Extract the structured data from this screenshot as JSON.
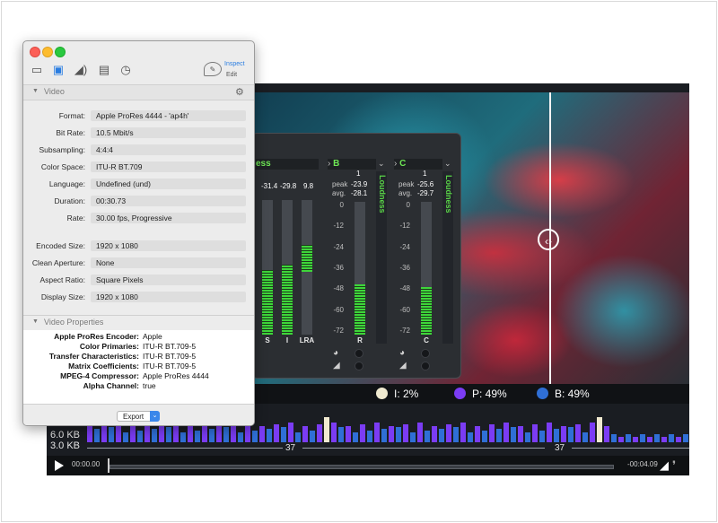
{
  "window": {
    "toolbar": {
      "inspect_label": "Inspect",
      "edit_label": "Edit",
      "icons": [
        "document-icon",
        "video-icon",
        "audio-icon",
        "subtitle-icon",
        "clock-icon"
      ]
    },
    "video_section": {
      "title": "Video",
      "properties": [
        {
          "label": "Format:",
          "value": "Apple ProRes 4444 - 'ap4h'"
        },
        {
          "label": "Bit Rate:",
          "value": "10.5 Mbit/s"
        },
        {
          "label": "Subsampling:",
          "value": "4:4:4"
        },
        {
          "label": "Color Space:",
          "value": "ITU-R BT.709"
        },
        {
          "label": "Language:",
          "value": "Undefined (und)"
        },
        {
          "label": "Duration:",
          "value": "00:30.73"
        },
        {
          "label": "Rate:",
          "value": "30.00 fps, Progressive"
        },
        {
          "label": "Encoded Size:",
          "value": "1920 x 1080"
        },
        {
          "label": "Clean Aperture:",
          "value": "None"
        },
        {
          "label": "Aspect Ratio:",
          "value": "Square Pixels"
        },
        {
          "label": "Display Size:",
          "value": "1920 x 1080"
        }
      ]
    },
    "video_properties": {
      "title": "Video Properties",
      "rows": [
        {
          "label": "Apple ProRes Encoder:",
          "value": "Apple"
        },
        {
          "label": "Color Primaries:",
          "value": "ITU-R BT.709-5"
        },
        {
          "label": "Transfer Characteristics:",
          "value": "ITU-R BT.709-5"
        },
        {
          "label": "Matrix Coefficients:",
          "value": "ITU-R BT.709-5"
        },
        {
          "label": "MPEG-4 Compressor:",
          "value": "Apple ProRes 4444"
        },
        {
          "label": "Alpha Channel:",
          "value": "true"
        }
      ]
    },
    "export_label": "Export"
  },
  "loudness": {
    "channels": [
      {
        "name": "B",
        "tab": "Loudness",
        "channel_count": "1",
        "peak": "-23.9",
        "avg": "-28.1",
        "meter_letter": "R",
        "level": 0.38
      },
      {
        "name": "C",
        "tab": "Loudness",
        "channel_count": "1",
        "peak": "-25.6",
        "avg": "-29.7",
        "meter_letter": "C",
        "level": 0.36
      }
    ],
    "left_group": {
      "header_partial": "ess",
      "values": [
        "-31.4",
        "-29.8",
        "9.8"
      ],
      "meter_letters": [
        "S",
        "I",
        "LRA"
      ],
      "levels": [
        0.48,
        0.52,
        0.2
      ]
    },
    "scale": [
      "0",
      "-12",
      "-24",
      "-36",
      "-48",
      "-60",
      "-72"
    ],
    "peak_label": "peak",
    "avg_label": "avg."
  },
  "player": {
    "stats": [
      {
        "label": "I: 2%",
        "color": "#f0ead0"
      },
      {
        "label": "P: 49%",
        "color": "#7b3cf4"
      },
      {
        "label": "B: 49%",
        "color": "#2f6fd6"
      }
    ],
    "bitrate_axis": [
      "6.0 KB",
      "3.0 KB"
    ],
    "gop_label": "37",
    "time_start": "00:00.00",
    "time_end": "-00:04.09"
  }
}
